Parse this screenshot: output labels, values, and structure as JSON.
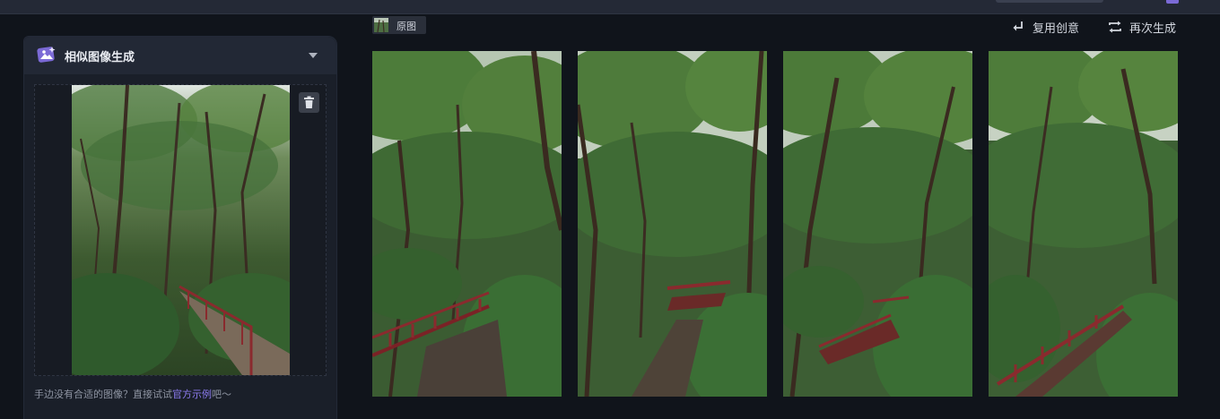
{
  "panel": {
    "title": "相似图像生成",
    "hint_prefix": "手边没有合适的图像？直接试试",
    "hint_link": "官方示例",
    "hint_suffix": "吧～"
  },
  "toolbar": {
    "original_label": "原图",
    "reuse_label": "复用创意",
    "regenerate_label": "再次生成"
  },
  "results": [
    {
      "name": "result-image-1"
    },
    {
      "name": "result-image-2"
    },
    {
      "name": "result-image-3"
    },
    {
      "name": "result-image-4"
    }
  ],
  "colors": {
    "background": "#10141b",
    "panel": "#1a1f29",
    "accent": "#8c7cf0",
    "railing": "#8a2a2e"
  },
  "icons": [
    "image-generate-icon",
    "chevron-down-icon",
    "trash-icon",
    "reuse-icon",
    "regenerate-icon"
  ]
}
